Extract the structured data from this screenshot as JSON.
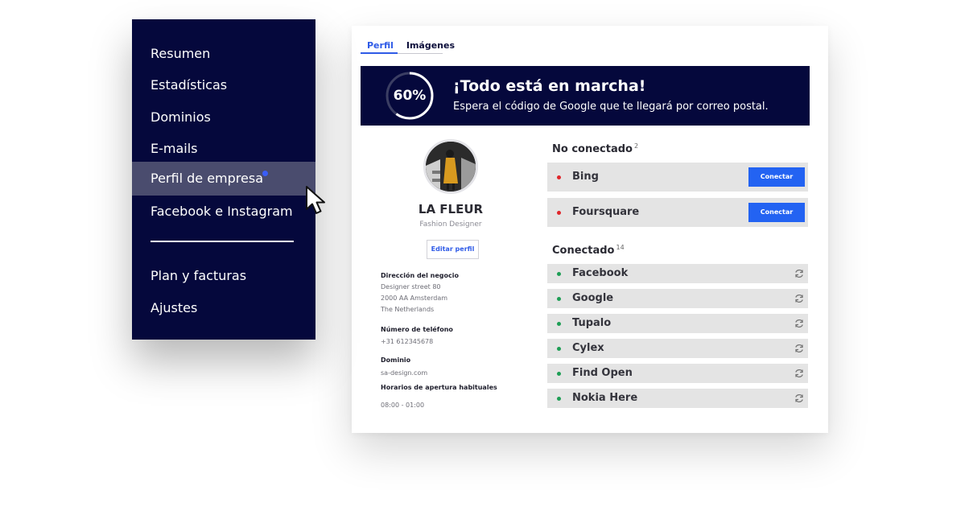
{
  "sidebar": {
    "items": [
      {
        "label": "Resumen"
      },
      {
        "label": "Estadísticas"
      },
      {
        "label": "Dominios"
      },
      {
        "label": "E-mails"
      },
      {
        "label": "Perfil de empresa"
      },
      {
        "label": "Facebook e Instagram"
      },
      {
        "label": "Plan y facturas"
      },
      {
        "label": "Ajustes"
      }
    ],
    "active_index": 4
  },
  "tabs": [
    {
      "label": "Perfil"
    },
    {
      "label": "Imágenes"
    }
  ],
  "banner": {
    "progress_text": "60%",
    "progress_value": 0.6,
    "title": "¡Todo está en marcha!",
    "subtitle": "Espera el código de Google que te llegará por correo postal."
  },
  "profile": {
    "name": "LA FLEUR",
    "role": "Fashion Designer",
    "edit_label": "Editar perfil",
    "address_heading": "Dirección del negocio",
    "address_lines": [
      "Designer street 80",
      "2000 AA Amsterdam",
      "The Netherlands"
    ],
    "phone_heading": "Número de teléfono",
    "phone": "+31 612345678",
    "domain_heading": "Dominio",
    "domain": "sa-design.com",
    "hours_heading": "Horarios de apertura habituales",
    "hours": "08:00 - 01:00"
  },
  "not_connected": {
    "title": "No conectado",
    "count": "2",
    "items": [
      {
        "label": "Bing",
        "button": "Conectar"
      },
      {
        "label": "Foursquare",
        "button": "Conectar"
      }
    ]
  },
  "connected": {
    "title": "Conectado",
    "count": "14",
    "items": [
      {
        "label": "Facebook"
      },
      {
        "label": "Google"
      },
      {
        "label": "Tupalo"
      },
      {
        "label": "Cylex"
      },
      {
        "label": "Find Open"
      },
      {
        "label": "Nokia Here"
      }
    ]
  },
  "colors": {
    "navy": "#05083c",
    "accent": "#2f5be7",
    "button": "#2363f2",
    "status_red": "#e0262b",
    "status_green": "#1e9e55"
  }
}
